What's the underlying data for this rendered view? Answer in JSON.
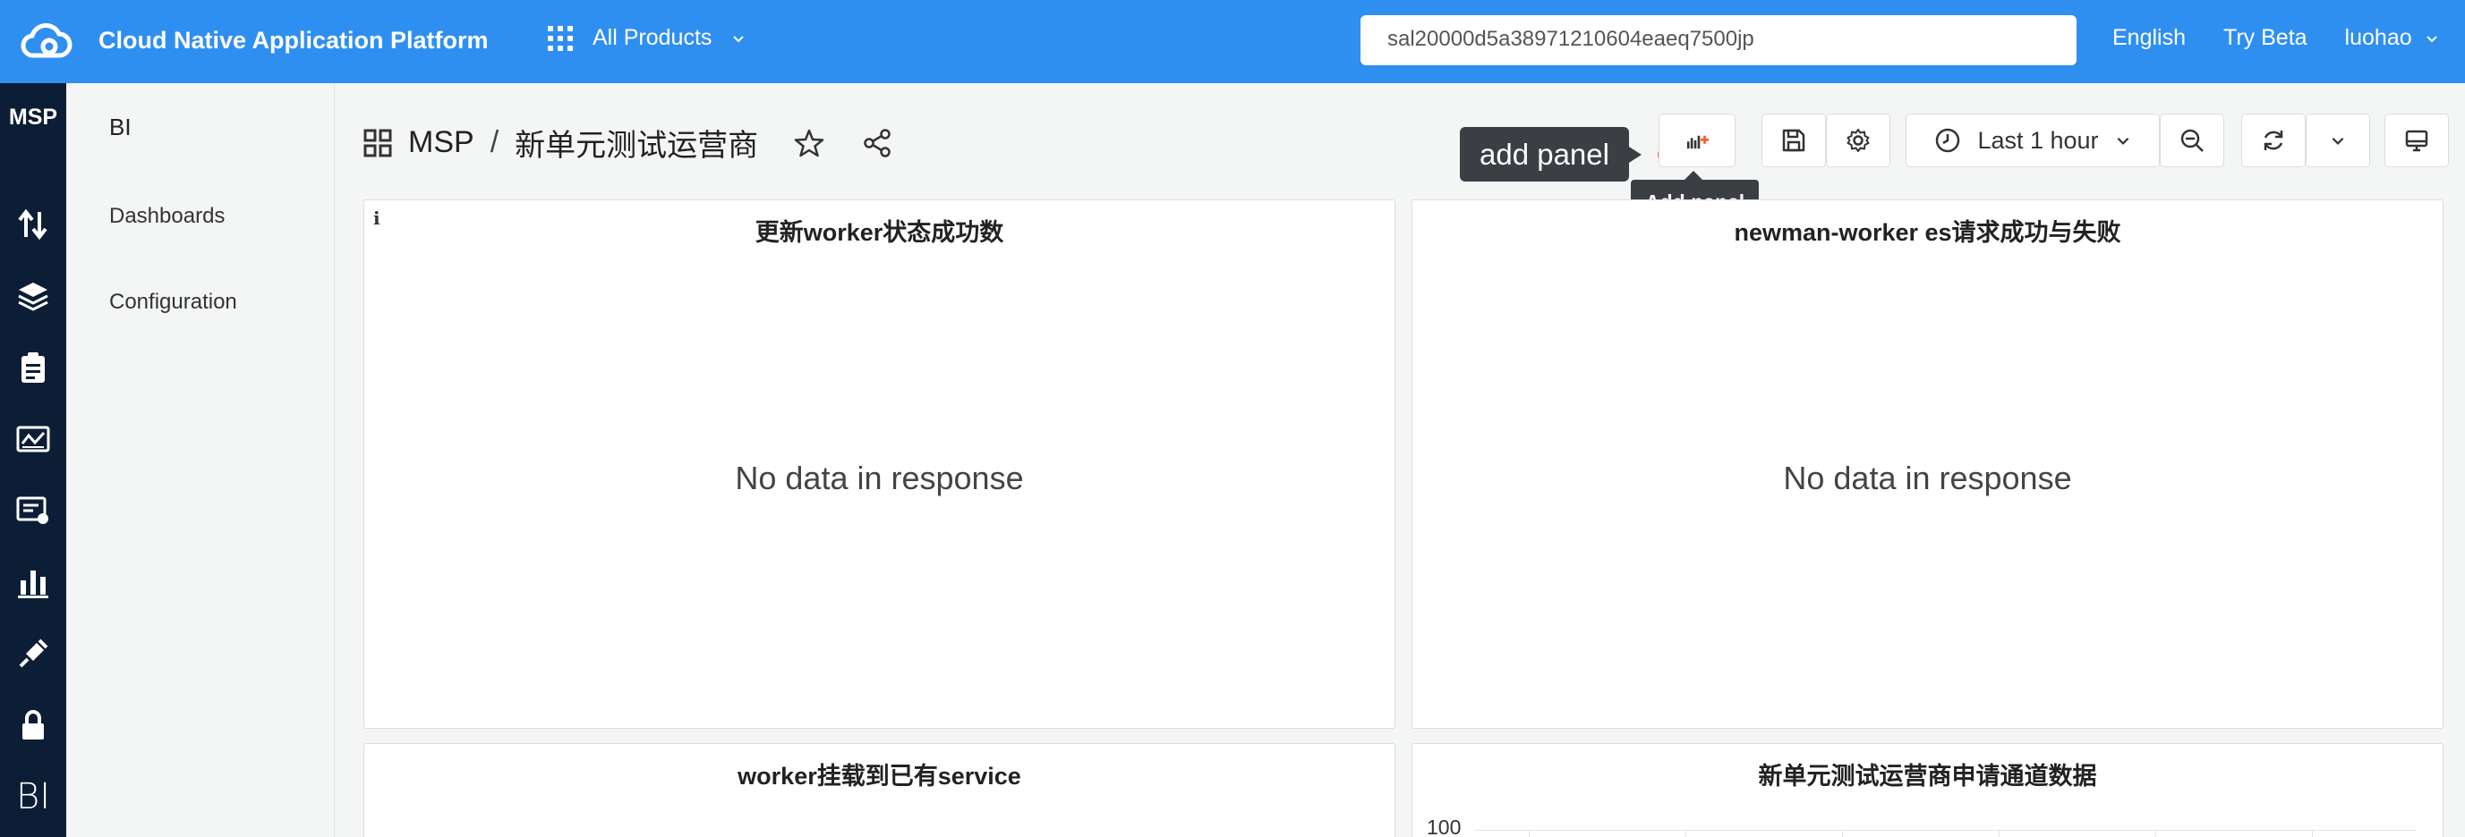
{
  "header": {
    "app_title": "Cloud Native Application Platform",
    "products_label": "All Products",
    "search_value": "sal20000d5a38971210604eaeq7500jp",
    "language": "English",
    "try_beta": "Try Beta",
    "user": "luohao",
    "brand_color": "#2f8ff0"
  },
  "rail": {
    "title": "MSP",
    "icons": [
      "transfer-icon",
      "layers-icon",
      "clipboard-icon",
      "monitor-chart-icon",
      "certificate-icon",
      "bar-chart-icon",
      "plug-icon",
      "lock-icon"
    ],
    "bottom_label": "BI",
    "background": "#0c1d36"
  },
  "subnav": {
    "title": "BI",
    "items": [
      {
        "label": "Dashboards"
      },
      {
        "label": "Configuration"
      }
    ]
  },
  "breadcrumb": {
    "root": "MSP",
    "separator": "/",
    "current": "新单元测试运营商"
  },
  "toolbar": {
    "time_range": "Last 1 hour",
    "tooltip_big": "add panel",
    "tooltip_small": "Add panel",
    "accent": "#ff5a1f"
  },
  "panels": [
    {
      "title": "更新worker状态成功数",
      "message": "No data in response",
      "info": "i"
    },
    {
      "title": "newman-worker es请求成功与失败",
      "message": "No data in response"
    },
    {
      "title": "worker挂载到已有service",
      "message": ""
    },
    {
      "title": "新单元测试运营商申请通道数据",
      "message": "",
      "y_top_tick": "100"
    }
  ]
}
